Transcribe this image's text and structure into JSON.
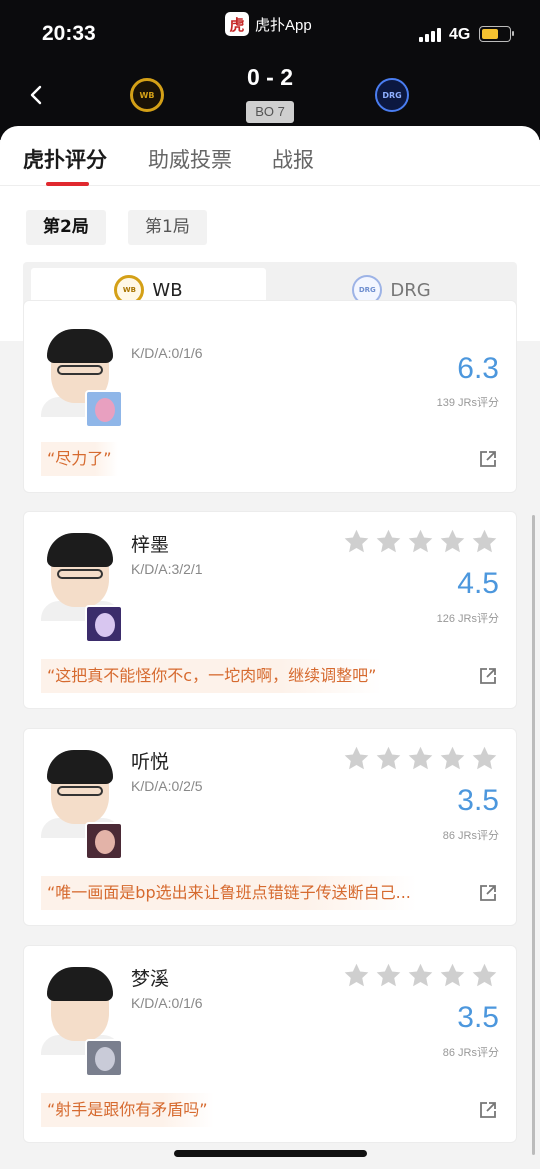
{
  "status_bar": {
    "time": "20:33",
    "network": "4G",
    "battery_level": 0.6
  },
  "app": {
    "logo_char": "虎",
    "name": "虎扑App"
  },
  "match": {
    "score": "0 - 2",
    "format": "BO 7",
    "home_logo": "WB",
    "away_logo": "DRG"
  },
  "tabs": [
    {
      "label": "虎扑评分",
      "active": true
    },
    {
      "label": "助威投票",
      "active": false
    },
    {
      "label": "战报",
      "active": false
    }
  ],
  "games": [
    {
      "label": "第2局",
      "active": true
    },
    {
      "label": "第1局",
      "active": false
    }
  ],
  "teams": [
    {
      "name": "WB",
      "logo": "WB",
      "active": true
    },
    {
      "name": "DRG",
      "logo": "DRG",
      "active": false
    }
  ],
  "players": [
    {
      "name": "",
      "kda": "K/D/A:0/1/6",
      "rating": "6.3",
      "votes": "139 JRs评分",
      "comment": "“尽力了”",
      "stars_filled": 0
    },
    {
      "name": "梓墨",
      "kda": "K/D/A:3/2/1",
      "rating": "4.5",
      "votes": "126 JRs评分",
      "comment": "“这把真不能怪你不c，一坨肉啊，继续调整吧”",
      "stars_filled": 0
    },
    {
      "name": "听悦",
      "kda": "K/D/A:0/2/5",
      "rating": "3.5",
      "votes": "86 JRs评分",
      "comment": "“唯一画面是bp选出来让鲁班点错链子传送断自己...",
      "stars_filled": 0
    },
    {
      "name": "梦溪",
      "kda": "K/D/A:0/1/6",
      "rating": "3.5",
      "votes": "86 JRs评分",
      "comment": "“射手是跟你有矛盾吗”",
      "stars_filled": 0
    }
  ],
  "colors": {
    "accent": "#e0282e",
    "rating": "#4c97dd",
    "comment": "#d66a2f",
    "star_empty": "#cfcfcf"
  },
  "icons": {
    "back": "chevron-left-icon",
    "star": "star-icon",
    "share": "share-icon"
  }
}
